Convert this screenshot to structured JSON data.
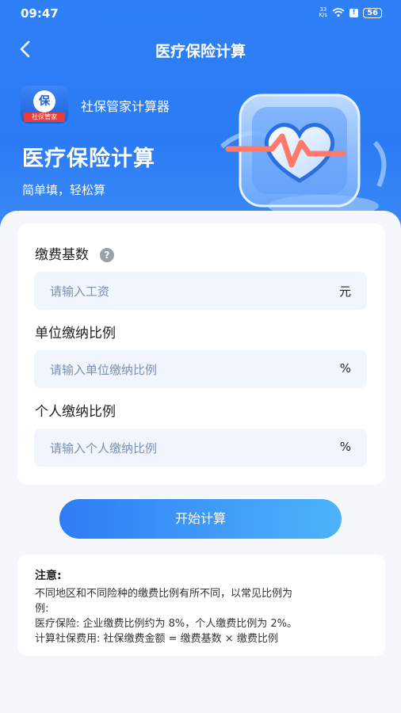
{
  "status": {
    "time": "09:47",
    "speed_top": "33",
    "speed_bottom": "K/s",
    "alert": "!",
    "battery": "56"
  },
  "nav": {
    "title": "医疗保险计算"
  },
  "brand": {
    "logo_char": "保",
    "logo_ribbon": "社保管家",
    "app_name": "社保管家计算器"
  },
  "hero": {
    "title": "医疗保险计算",
    "subtitle": "简单填，轻松算"
  },
  "form": {
    "base": {
      "label": "缴费基数",
      "help": "?",
      "placeholder": "请输入工资",
      "unit": "元"
    },
    "company": {
      "label": "单位缴纳比例",
      "placeholder": "请输入单位缴纳比例",
      "unit": "%"
    },
    "personal": {
      "label": "个人缴纳比例",
      "placeholder": "请输入个人缴纳比例",
      "unit": "%"
    }
  },
  "action": {
    "calculate": "开始计算"
  },
  "notice": {
    "title": "注意:",
    "lines": [
      "不同地区和不同险种的缴费比例有所不同，以常见比例为",
      "例:",
      "医疗保险: 企业缴费比例约为 8%，个人缴费比例为 2%。",
      "计算社保费用: 社保缴费金额 = 缴费基数 × 缴费比例"
    ]
  },
  "colors": {
    "primary": "#2f80f7",
    "button_end": "#4cb4fa",
    "field_bg": "#f1f5fd",
    "accent_red": "#e73c3c"
  },
  "icons": {
    "back": "chevron-left-icon",
    "help": "question-circle-icon",
    "wifi": "wifi-icon",
    "illustration": "heart-pulse-illustration"
  }
}
